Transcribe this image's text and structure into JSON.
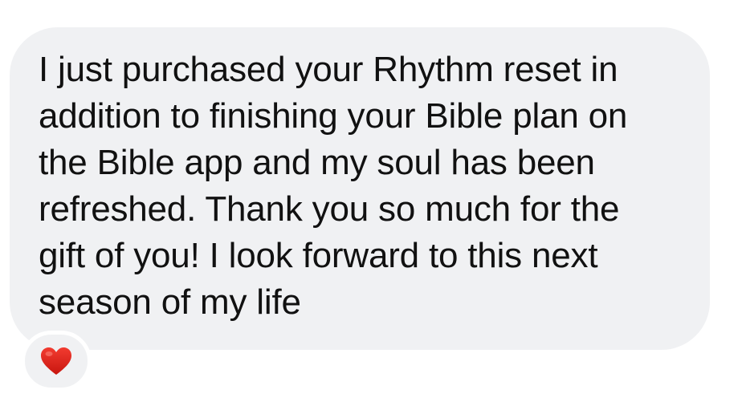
{
  "message": {
    "lines": [
      "I just purchased your Rhythm reset in",
      "addition to finishing your Bible plan on",
      "the Bible app and my soul has been",
      "refreshed. Thank you so much for the",
      "gift of you! I look forward to this next",
      "season of my life"
    ]
  },
  "reaction": {
    "icon": "red-heart-icon",
    "color": "#e0241b"
  },
  "colors": {
    "bubble": "#f0f1f3",
    "text": "#111111",
    "background": "#ffffff"
  }
}
